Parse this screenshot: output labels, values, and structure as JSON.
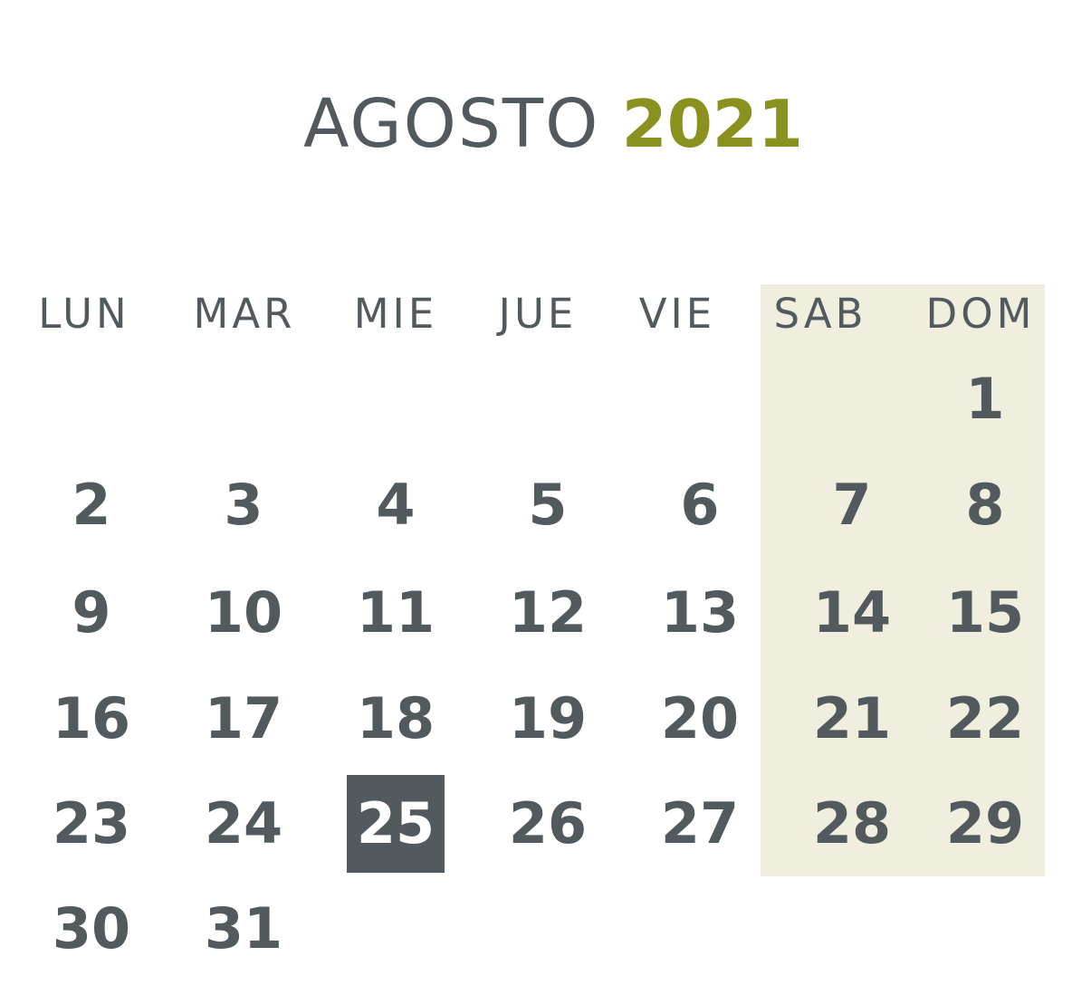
{
  "title": {
    "month": "AGOSTO",
    "year": "2021"
  },
  "colors": {
    "text": "#535a5e",
    "accent": "#8b911e",
    "weekend_bg": "#efeedf",
    "today_bg": "#535a5e",
    "today_text": "#ffffff"
  },
  "weekdays": [
    "LUN",
    "MAR",
    "MIE",
    "JUE",
    "VIE",
    "SAB",
    "DOM"
  ],
  "weeks": [
    [
      "",
      "",
      "",
      "",
      "",
      "",
      "1"
    ],
    [
      "2",
      "3",
      "4",
      "5",
      "6",
      "7",
      "8"
    ],
    [
      "9",
      "10",
      "11",
      "12",
      "13",
      "14",
      "15"
    ],
    [
      "16",
      "17",
      "18",
      "19",
      "20",
      "21",
      "22"
    ],
    [
      "23",
      "24",
      "25",
      "26",
      "27",
      "28",
      "29"
    ],
    [
      "30",
      "31",
      "",
      "",
      "",
      "",
      ""
    ]
  ],
  "highlighted_day": "25"
}
